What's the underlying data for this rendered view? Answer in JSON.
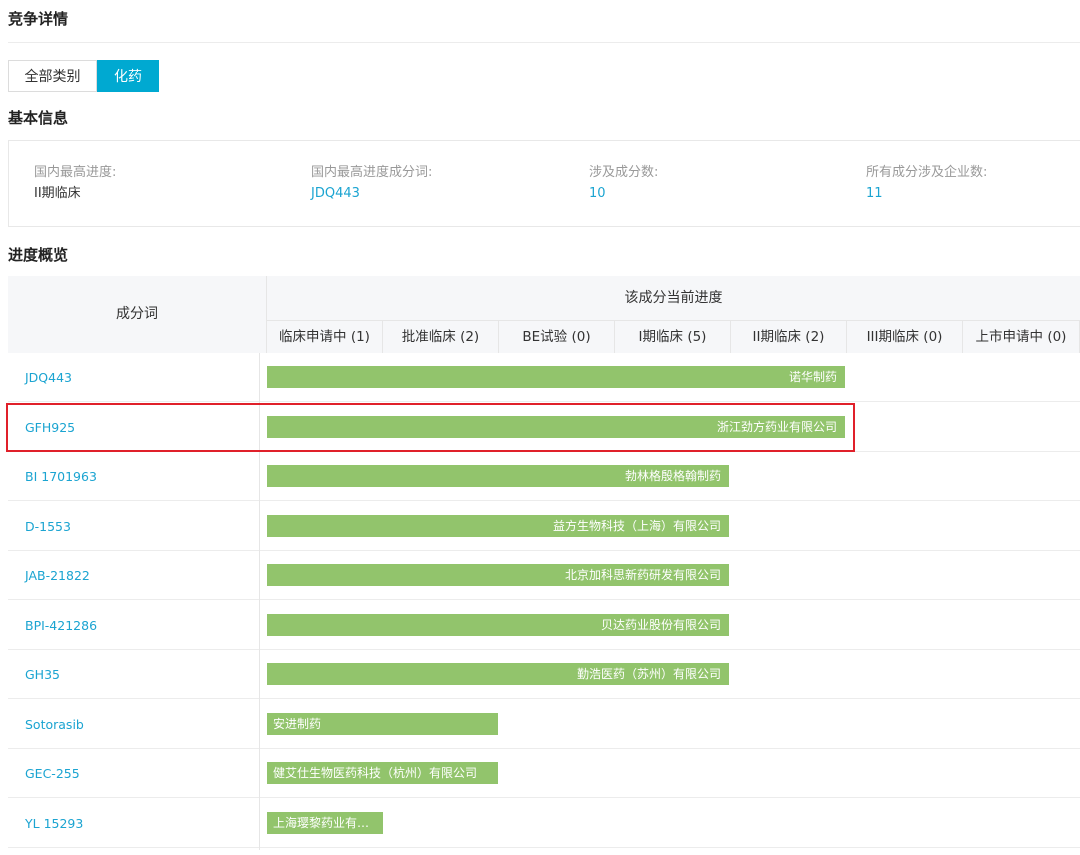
{
  "page": {
    "title": "竞争详情"
  },
  "tabs": [
    {
      "label": "全部类别",
      "active": false
    },
    {
      "label": "化药",
      "active": true
    }
  ],
  "basic_info": {
    "title": "基本信息",
    "items": [
      {
        "label": "国内最高进度:",
        "value": "II期临床"
      },
      {
        "label": "国内最高进度成分词:",
        "value": "JDQ443"
      },
      {
        "label": "涉及成分数:",
        "value": "10"
      },
      {
        "label": "所有成分涉及企业数:",
        "value": "11"
      }
    ]
  },
  "progress": {
    "title": "进度概览",
    "name_header": "成分词",
    "group_header": "该成分当前进度",
    "stages": [
      "临床申请中 (1)",
      "批准临床 (2)",
      "BE试验 (0)",
      "I期临床 (5)",
      "II期临床 (2)",
      "III期临床 (0)",
      "上市申请中 (0)"
    ],
    "rows": [
      {
        "name": "JDQ443",
        "company": "诺华制药",
        "stage_reached": 5
      },
      {
        "name": "GFH925",
        "company": "浙江劲方药业有限公司",
        "stage_reached": 5,
        "highlighted": true
      },
      {
        "name": "BI 1701963",
        "company": "勃林格殷格翰制药",
        "stage_reached": 4
      },
      {
        "name": "D-1553",
        "company": "益方生物科技（上海）有限公司",
        "stage_reached": 4
      },
      {
        "name": "JAB-21822",
        "company": "北京加科思新药研发有限公司",
        "stage_reached": 4
      },
      {
        "name": "BPI-421286",
        "company": "贝达药业股份有限公司",
        "stage_reached": 4
      },
      {
        "name": "GH35",
        "company": "勤浩医药（苏州）有限公司",
        "stage_reached": 4
      },
      {
        "name": "Sotorasib",
        "company": "安进制药",
        "stage_reached": 2
      },
      {
        "name": "GEC-255",
        "company": "健艾仕生物医药科技（杭州）有限公司",
        "stage_reached": 2
      },
      {
        "name": "YL 15293",
        "company": "上海璎黎药业有…",
        "stage_reached": 1
      }
    ]
  },
  "colors": {
    "accent": "#00a9d1",
    "link": "#1ba4d1",
    "bar": "#92c46c",
    "highlight_border": "#e0202a"
  }
}
